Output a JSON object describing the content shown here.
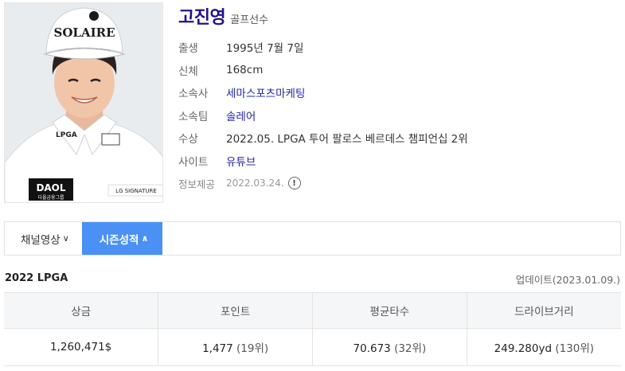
{
  "profile": {
    "name": "고진영",
    "job": "골프선수",
    "rows": [
      {
        "label": "출생",
        "value": "1995년 7월 7일"
      },
      {
        "label": "신체",
        "value": "168cm"
      },
      {
        "label": "소속사",
        "value": "세마스포츠마케팅"
      },
      {
        "label": "소속팀",
        "value": "솔레어"
      },
      {
        "label": "수상",
        "value": "2022.05. LPGA 투어 팔로스 베르데스 챔피언십 2위"
      },
      {
        "label": "사이트",
        "value": "유튜브"
      }
    ],
    "source_label": "정보제공",
    "source_date": "2022.03.24.",
    "info_icon": "!"
  },
  "photo": {
    "cap_text": "SOLAIRE",
    "collar_text": "LPGA",
    "sponsor_text": "DAOL",
    "sponsor_sub": "다올금융그룹",
    "sleeve_text": "LG SIGNATURE"
  },
  "tabs": [
    {
      "label": "채널영상",
      "caret": "∨"
    },
    {
      "label": "시즌성적",
      "caret": "∧"
    }
  ],
  "season": {
    "title": "2022 LPGA",
    "update": "업데이트(2023.01.09.)",
    "headers": [
      "상금",
      "포인트",
      "평균타수",
      "드라이브거리"
    ],
    "values": [
      {
        "value": "1,260,471$",
        "rank": ""
      },
      {
        "value": "1,477",
        "rank": "(19위)"
      },
      {
        "value": "70.673",
        "rank": "(32위)"
      },
      {
        "value": "249.280yd",
        "rank": "(130위)"
      }
    ]
  }
}
